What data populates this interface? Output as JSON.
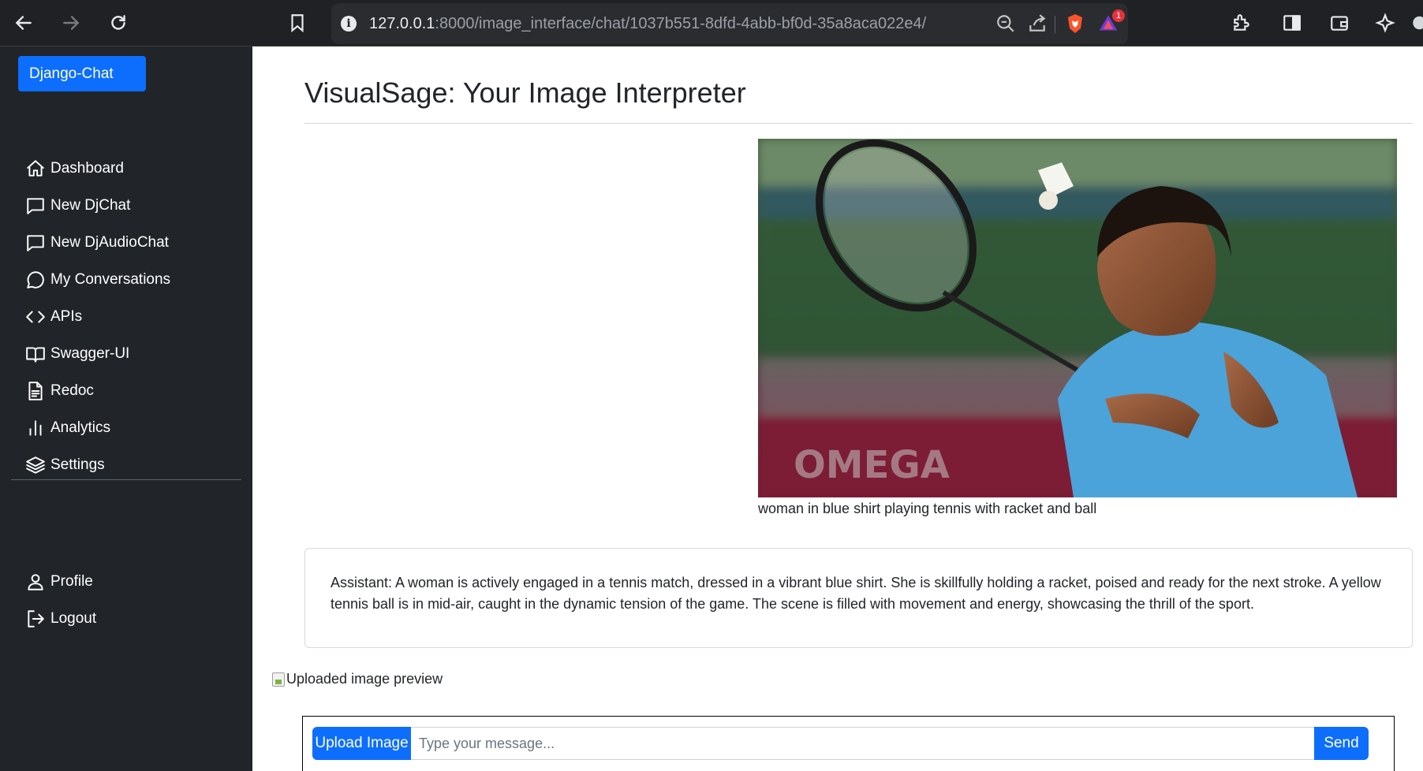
{
  "browser": {
    "url_host": "127.0.0.1",
    "url_rest": ":8000/image_interface/chat/1037b551-8dfd-4abb-bf0d-35a8aca022e4/",
    "rewards_badge": "1"
  },
  "sidebar": {
    "brand": "Django-Chat",
    "items": [
      {
        "label": "Dashboard",
        "icon": "home-icon"
      },
      {
        "label": "New DjChat",
        "icon": "chat-square-icon"
      },
      {
        "label": "New DjAudioChat",
        "icon": "chat-square-icon"
      },
      {
        "label": "My Conversations",
        "icon": "chat-bubble-icon"
      },
      {
        "label": "APIs",
        "icon": "code-icon"
      },
      {
        "label": "Swagger-UI",
        "icon": "book-icon"
      },
      {
        "label": "Redoc",
        "icon": "document-icon"
      },
      {
        "label": "Analytics",
        "icon": "bar-chart-icon"
      },
      {
        "label": "Settings",
        "icon": "layers-icon"
      }
    ],
    "account_items": [
      {
        "label": "Profile",
        "icon": "person-icon"
      },
      {
        "label": "Logout",
        "icon": "logout-icon"
      }
    ]
  },
  "main": {
    "title": "VisualSage: Your Image Interpreter",
    "image_caption": "woman in blue shirt playing tennis with racket and ball",
    "assistant_message": "Assistant: A woman is actively engaged in a tennis match, dressed in a vibrant blue shirt. She is skillfully holding a racket, poised and ready for the next stroke. A yellow tennis ball is in mid-air, caught in the dynamic tension of the game. The scene is filled with movement and energy, showcasing the thrill of the sport.",
    "preview_alt": "Uploaded image preview",
    "photo_watermark": "OMEGA"
  },
  "form": {
    "upload_label": "Upload Image",
    "message_placeholder": "Type your message...",
    "message_value": "",
    "send_label": "Send"
  },
  "colors": {
    "primary": "#0d6efd",
    "sidebar_bg": "#212529",
    "chrome_bg": "#202124"
  }
}
